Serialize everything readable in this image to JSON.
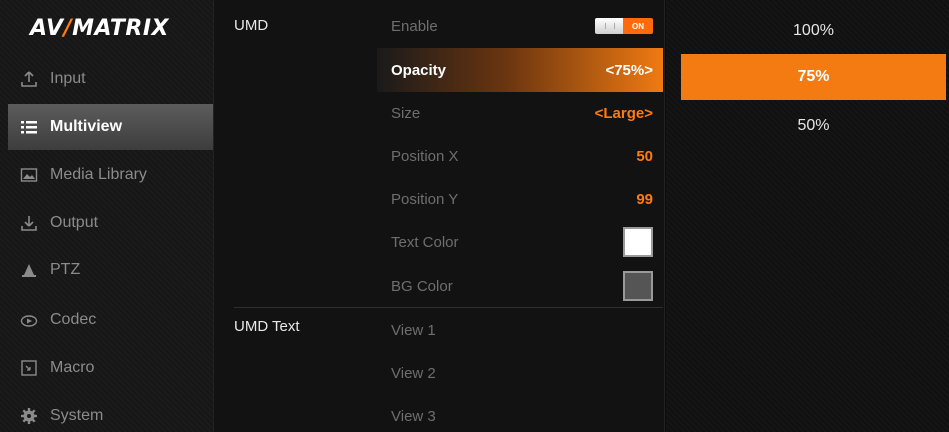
{
  "brand": {
    "logo_prefix": "AV",
    "logo_accent": "/",
    "logo_suffix": "MATRIX",
    "accent_color": "#ff7a10"
  },
  "sidebar": {
    "items": [
      {
        "label": "Input",
        "icon": "upload-icon",
        "active": false
      },
      {
        "label": "Multiview",
        "icon": "list-icon",
        "active": true
      },
      {
        "label": "Media Library",
        "icon": "image-icon",
        "active": false
      },
      {
        "label": "Output",
        "icon": "download-icon",
        "active": false
      },
      {
        "label": "PTZ",
        "icon": "camera-icon",
        "active": false
      },
      {
        "label": "Codec",
        "icon": "codec-icon",
        "active": false
      },
      {
        "label": "Macro",
        "icon": "macro-icon",
        "active": false
      },
      {
        "label": "System",
        "icon": "gear-icon",
        "active": false
      }
    ]
  },
  "umd": {
    "group_label": "UMD",
    "enable": {
      "label": "Enable",
      "toggle_text": "ON",
      "state": "on"
    },
    "opacity": {
      "label": "Opacity",
      "value": "<75%>"
    },
    "size": {
      "label": "Size",
      "value": "<Large>"
    },
    "position_x": {
      "label": "Position X",
      "value": "50"
    },
    "position_y": {
      "label": "Position Y",
      "value": "99"
    },
    "text_color": {
      "label": "Text Color",
      "color": "#ffffff"
    },
    "bg_color": {
      "label": "BG Color",
      "color": "#555555"
    }
  },
  "umd_text": {
    "group_label": "UMD Text",
    "views": [
      "View 1",
      "View 2",
      "View 3"
    ]
  },
  "options": {
    "items": [
      "100%",
      "75%",
      "50%"
    ],
    "selected": "75%"
  }
}
